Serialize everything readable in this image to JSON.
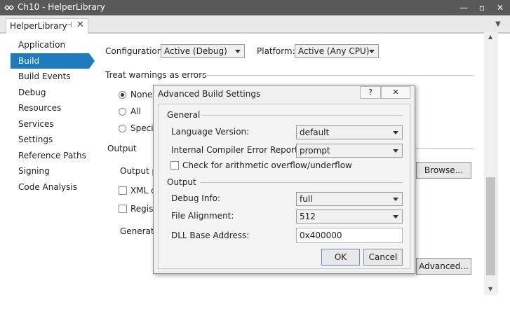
{
  "window": {
    "title": "Ch10 - HelperLibrary"
  },
  "tab": {
    "label": "HelperLibrary"
  },
  "nav": {
    "items": [
      "Application",
      "Build",
      "Build Events",
      "Debug",
      "Resources",
      "Services",
      "Settings",
      "Reference Paths",
      "Signing",
      "Code Analysis"
    ],
    "active": "Build"
  },
  "build": {
    "configuration_label": "Configuration:",
    "configuration_value": "Active (Debug)",
    "platform_label": "Platform:",
    "platform_value": "Active (Any CPU)",
    "warnings_heading": "Treat warnings as errors",
    "radio_none": "None",
    "radio_all": "All",
    "radio_specific": "Specifi",
    "output_heading": "Output",
    "output_path_label": "Output pa",
    "xml_label": "XML d",
    "register_label": "Registe",
    "generate_label": "Generate",
    "browse_button": "Browse...",
    "advanced_button": "Advanced..."
  },
  "dialog": {
    "title": "Advanced Build Settings",
    "help_icon": "?",
    "close_icon": "✕",
    "general_heading": "General",
    "language_version_label": "Language Version:",
    "language_version_value": "default",
    "ice_reporting_label": "Internal Compiler Error Reporting:",
    "ice_reporting_value": "prompt",
    "overflow_label": "Check for arithmetic overflow/underflow",
    "output_heading": "Output",
    "debug_info_label": "Debug Info:",
    "debug_info_value": "full",
    "file_alignment_label": "File Alignment:",
    "file_alignment_value": "512",
    "dll_base_label": "DLL Base Address:",
    "dll_base_value": "0x400000",
    "ok_button": "OK",
    "cancel_button": "Cancel"
  },
  "colors": {
    "titlebar": "#595959",
    "accent": "#1e7bc0"
  }
}
